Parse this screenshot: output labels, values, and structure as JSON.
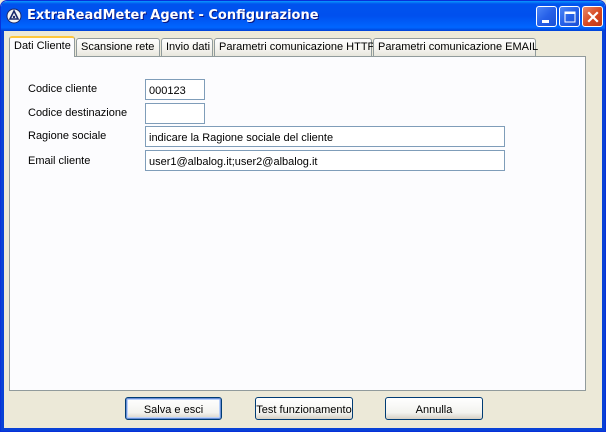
{
  "window": {
    "title": "ExtraReadMeter Agent - Configurazione"
  },
  "tabs": [
    {
      "label": "Dati Cliente",
      "active": true
    },
    {
      "label": "Scansione rete",
      "active": false
    },
    {
      "label": "Invio dati",
      "active": false
    },
    {
      "label": "Parametri comunicazione HTTP",
      "active": false
    },
    {
      "label": "Parametri comunicazione EMAIL",
      "active": false
    }
  ],
  "form": {
    "codice_cliente": {
      "label": "Codice cliente",
      "value": "000123"
    },
    "codice_destinazione": {
      "label": "Codice destinazione",
      "value": ""
    },
    "ragione_sociale": {
      "label": "Ragione sociale",
      "value": "indicare la Ragione sociale del cliente"
    },
    "email_cliente": {
      "label": "Email cliente",
      "value": "user1@albalog.it;user2@albalog.it"
    }
  },
  "buttons": {
    "save": "Salva e esci",
    "test": "Test funzionamento",
    "cancel": "Annulla"
  },
  "icons": {
    "app": "app-icon",
    "minimize": "minimize-icon",
    "maximize": "maximize-icon",
    "close": "close-icon"
  },
  "colors": {
    "titlebar": "#0054E3",
    "face": "#ECE9D8",
    "active_tab_accent": "#FFC73C",
    "close_button": "#D6461F"
  }
}
